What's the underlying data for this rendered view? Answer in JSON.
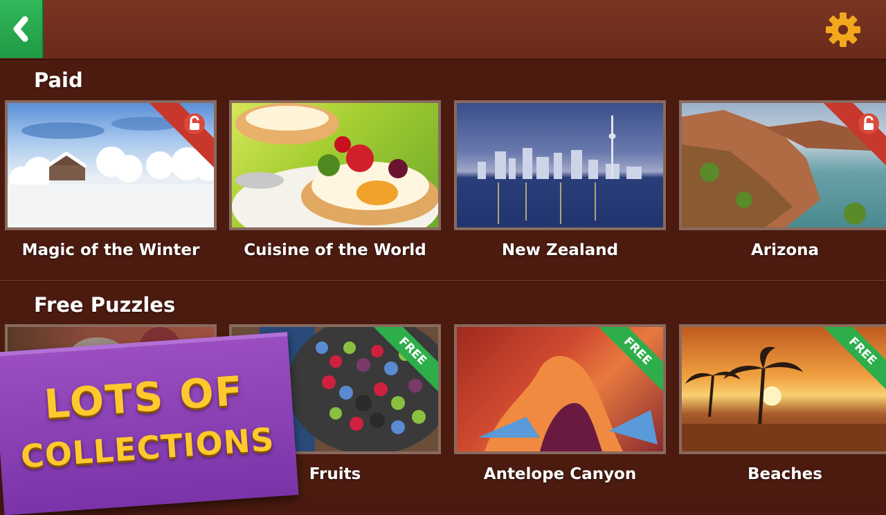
{
  "header": {
    "back_icon": "chevron-left-icon",
    "settings_icon": "gear-icon"
  },
  "sections": {
    "paid": {
      "title": "Paid",
      "items": [
        {
          "label": "Magic of the Winter",
          "badge_icon": "lock-icon"
        },
        {
          "label": "Cuisine of the World"
        },
        {
          "label": "New Zealand"
        },
        {
          "label": "Arizona",
          "badge_icon": "lock-icon"
        }
      ]
    },
    "free": {
      "title": "Free Puzzles",
      "items": [
        {
          "label": ""
        },
        {
          "label": "Fruits",
          "badge": "FREE"
        },
        {
          "label": "Antelope Canyon",
          "badge": "FREE"
        },
        {
          "label": "Beaches",
          "badge": "FREE"
        }
      ]
    }
  },
  "promo": {
    "line1": "LOTS OF",
    "line2": "COLLECTIONS"
  },
  "colors": {
    "accent_green": "#2eae4a",
    "lock_red": "#c8372c",
    "gear": "#f2a81d",
    "promo_purple": "#8a40b8",
    "promo_text": "#ffc92e"
  }
}
